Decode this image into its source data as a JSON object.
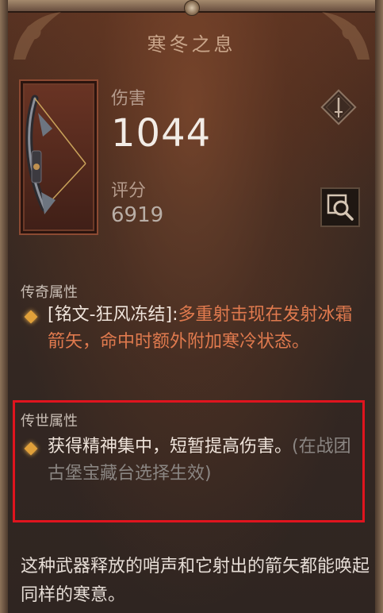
{
  "item": {
    "name": "寒冬之息",
    "damage_label": "伤害",
    "damage_value": "1044",
    "score_label": "评分",
    "score_value": "6919"
  },
  "legendary": {
    "header": "传奇属性",
    "aspect_name": "[铭文-狂风冻结]:",
    "effect": "多重射击现在发射冰霜箭矢，命中时额外附加寒冷状态。"
  },
  "heirloom": {
    "header": "传世属性",
    "effect": "获得精神集中，短暂提高伤害。",
    "note": "(在战团古堡宝藏台选择生效)"
  },
  "flavor_text": "这种武器释放的哨声和它射出的箭矢都能唤起同样的寒意。",
  "icons": {
    "weapon": "bow-icon",
    "compare": "sword-icon",
    "inspect": "magnifier-icon",
    "bullet": "diamond-bullet-icon"
  },
  "colors": {
    "legendary_text": "#e07a4e",
    "highlight_border": "#e0141e",
    "bullet": "#e0a03a"
  }
}
